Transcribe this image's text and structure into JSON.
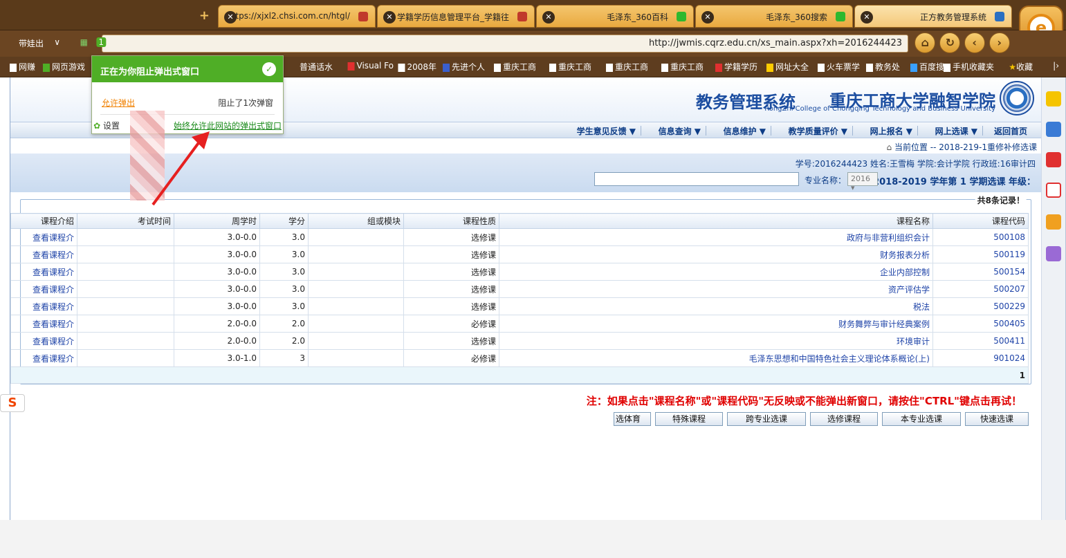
{
  "browser": {
    "tabs": [
      {
        "title": "正方教务管理系统",
        "active": true
      },
      {
        "title": "毛泽东_360搜索"
      },
      {
        "title": "毛泽东_360百科"
      },
      {
        "title": "学籍学历信息管理平台_学籍往"
      },
      {
        "title": "https://xjxl2.chsi.com.cn/htgl/"
      }
    ],
    "new_tab": "+",
    "url": "http://jwmis.cqrz.edu.cn/xs_main.aspx?xh=2016244423",
    "url_right_text": "带娃出",
    "popup_badge": "1",
    "bookmarks": [
      "收藏",
      "手机收藏夹",
      "百度搜",
      "教务处",
      "火车票学",
      "网址大全",
      "学籍学历",
      "重庆工商",
      "重庆工商",
      "重庆工商",
      "重庆工商",
      "先进个人",
      "2008年",
      "Visual Fo",
      "普通话水",
      "网页游戏",
      "网赚"
    ]
  },
  "popup": {
    "title": "正在为你阻止弹出式窗口",
    "blocked": "阻止了1次弹窗",
    "allow": "允许弹出",
    "always_allow": "始终允许此网站的弹出式窗口",
    "settings": "设置"
  },
  "site": {
    "school_name": "重庆工商大学融智学院",
    "school_en": "RongZhi College of Chongqing Technology and Business University",
    "system_name": "教务管理系统",
    "menu": [
      "返回首页",
      "网上选课",
      "网上报名",
      "教学质量评价",
      "信息维护",
      "信息查询",
      "学生意见反馈"
    ],
    "breadcrumb": "当前位置 -- 2018-219-1重修补修选课",
    "student_info": "学号:2016244423  姓名:王雪梅  学院:会计学院  行政班:16审计四",
    "term_label": "2018-2019 学年第 1 学期选课 年级：",
    "year_value": "2016",
    "major_label": "专业名称："
  },
  "table": {
    "legend": "共8条记录！",
    "headers": [
      "课程代码",
      "课程名称",
      "课程性质",
      "组或模块",
      "学分",
      "周学时",
      "考试时间",
      "课程介绍"
    ],
    "rows": [
      [
        "500108",
        "政府与非营利组织会计",
        "选修课",
        "",
        "3.0",
        "3.0-0.0",
        "",
        "查看课程介"
      ],
      [
        "500119",
        "财务报表分析",
        "选修课",
        "",
        "3.0",
        "3.0-0.0",
        "",
        "查看课程介"
      ],
      [
        "500154",
        "企业内部控制",
        "选修课",
        "",
        "3.0",
        "3.0-0.0",
        "",
        "查看课程介"
      ],
      [
        "500207",
        "资产评估学",
        "选修课",
        "",
        "3.0",
        "3.0-0.0",
        "",
        "查看课程介"
      ],
      [
        "500229",
        "税法",
        "选修课",
        "",
        "3.0",
        "3.0-0.0",
        "",
        "查看课程介"
      ],
      [
        "500405",
        "财务舞弊与审计经典案例",
        "必修课",
        "",
        "2.0",
        "2.0-0.0",
        "",
        "查看课程介"
      ],
      [
        "500411",
        "环境审计",
        "选修课",
        "",
        "2.0",
        "2.0-0.0",
        "",
        "查看课程介"
      ],
      [
        "901024",
        "毛泽东思想和中国特色社会主义理论体系概论(上)",
        "必修课",
        "",
        "3",
        "3.0-1.0",
        "",
        "查看课程介"
      ]
    ],
    "page": "1"
  },
  "notice": "注：如果点击\"课程名称\"或\"课程代码\"无反映或不能弹出新窗口，请按住\"CTRL\"键点击再试！",
  "buttons": [
    "快速选课",
    "本专业选课",
    "选修课程",
    "跨专业选课",
    "特殊课程",
    "选体育"
  ]
}
